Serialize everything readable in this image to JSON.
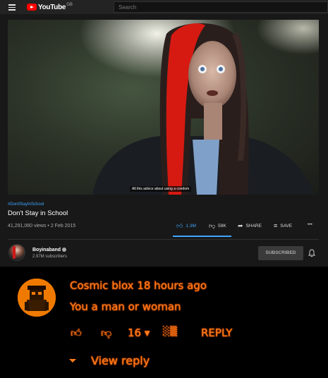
{
  "header": {
    "logo_text": "YouTube",
    "region": "GB",
    "search_placeholder": "Search"
  },
  "video": {
    "caption": "All this advice about using a condom",
    "hashtag": "#DontStayInSchool",
    "title": "Don't Stay in School",
    "views_date": "41,291,060 views • 2 Feb 2015",
    "like_count": "1.3M",
    "dislike_count": "59K",
    "share_label": "SHARE",
    "save_label": "SAVE",
    "more_label": "•••",
    "like_fraction": 0.96
  },
  "channel": {
    "name": "Boyinaband",
    "subscribers": "2.97M subscribers",
    "subscribe_label": "SUBSCRIBED"
  },
  "comment": {
    "author": "Cosmic blox",
    "time": "18 hours ago",
    "text": "You a man or woman",
    "likes": "16",
    "reply_label": "REPLY",
    "view_reply_label": "View reply"
  },
  "colors": {
    "accent_blue": "#3ea6ff",
    "youtube_red": "#ff0000",
    "comment_orange": "#ff7c18"
  }
}
